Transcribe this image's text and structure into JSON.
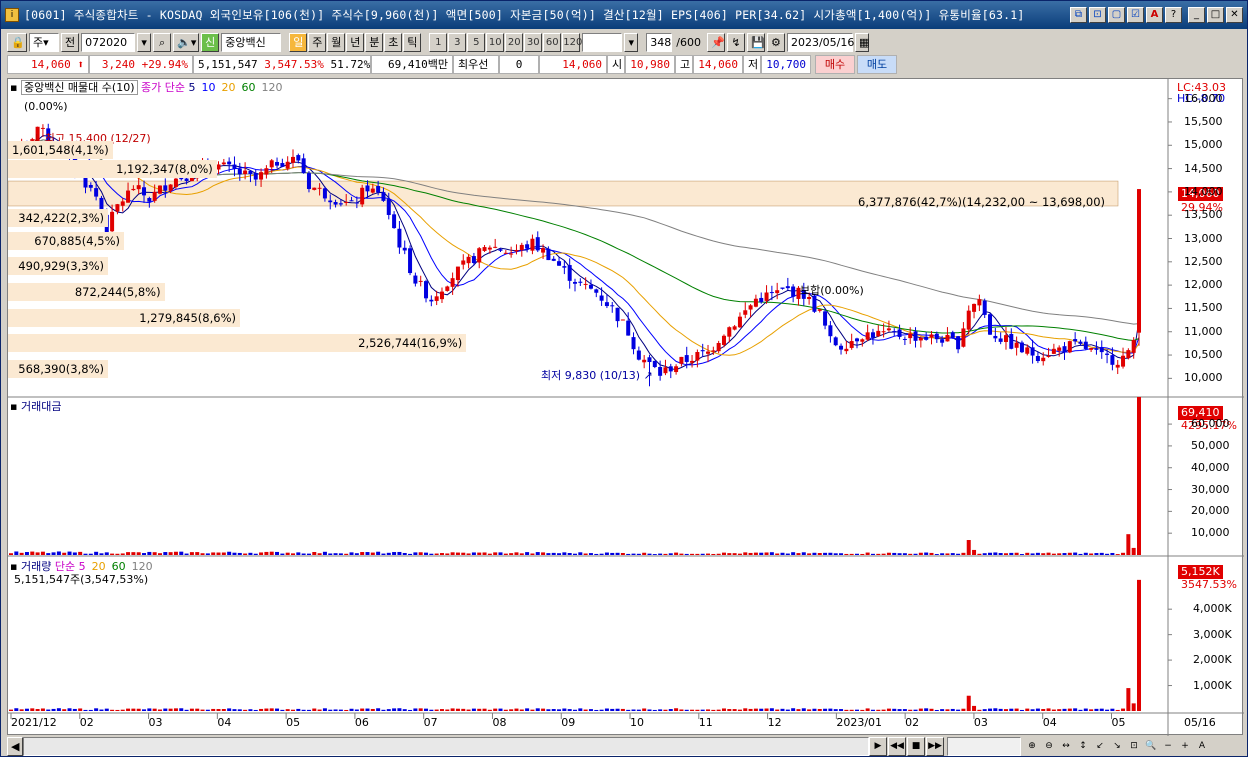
{
  "title": {
    "text": "[0601] 주식종합차트 - KOSDAQ 외국인보유[106(천)] 주식수[9,960(천)] 액면[500] 자본금[50(억)] 결산[12월] EPS[406] PER[34.62] 시가총액[1,400(억)] 유통비율[63.1]",
    "app_icon": "i"
  },
  "title_buttons": [
    {
      "name": "layout-icon",
      "glyph": "⧉"
    },
    {
      "name": "restore-icon",
      "glyph": "⊡"
    },
    {
      "name": "window-icon",
      "glyph": "▢"
    },
    {
      "name": "checkbox-icon",
      "glyph": "☑"
    },
    {
      "name": "font-icon",
      "glyph": "A"
    },
    {
      "name": "help-icon",
      "glyph": "?"
    },
    {
      "name": "minimize-icon",
      "glyph": "_"
    },
    {
      "name": "maximize-icon",
      "glyph": "□"
    },
    {
      "name": "close-icon",
      "glyph": "✕"
    }
  ],
  "toolbar": {
    "stock_type": "주",
    "prev_label": "전",
    "code": "072020",
    "stock_name": "중앙백신",
    "new_badge": "신",
    "periods": [
      "일",
      "주",
      "월",
      "년",
      "분",
      "초",
      "틱"
    ],
    "active_period": "일",
    "intervals": [
      "1",
      "3",
      "5",
      "10",
      "20",
      "30",
      "60",
      "120"
    ],
    "interval_input": "",
    "count": "348",
    "count_total": "/600",
    "date": "2023/05/16"
  },
  "quote": {
    "price": "14,060",
    "change": "3,240",
    "change_pct": "+29.94%",
    "volume": "5,151,547",
    "volume_pct": "3,547.53%",
    "turnover": "51.72%",
    "amount": "69,410백만",
    "bid_label": "최우선",
    "bid_value": "0",
    "ask_value": "14,060",
    "open_label": "시",
    "open": "10,980",
    "high_label": "고",
    "high": "14,060",
    "low_label": "저",
    "low": "10,700",
    "buy_label": "매수",
    "sell_label": "매도"
  },
  "price_panel": {
    "title": "중앙백신 매물대 수(10)",
    "ma_label": "종가 단순",
    "ma_periods": [
      "5",
      "10",
      "20",
      "60",
      "120"
    ],
    "ma_colors": [
      "#000080",
      "#0000ff",
      "#e8a000",
      "#008000",
      "#808080"
    ],
    "change_label": "(0.00%)",
    "lc": "LC:43.03",
    "hc": "HC:-8.70",
    "last_price_badge": "14,060",
    "last_pct": "29.94%",
    "high_marker": "최고 15,400 (12/27)",
    "low_marker": "최저 9,830 (10/13)",
    "flat_marker": "보합(0.00%)",
    "range_label": "6,377,876(42,7%)(14,232,00 ~ 13,698,00)",
    "volume_profile": [
      {
        "label": "1,601,548(4,1%)",
        "price": 14900,
        "width": 0.06
      },
      {
        "label": "1,192,347(8,0%)",
        "price": 14500,
        "width": 0.18
      },
      {
        "label": "342,422(2,3%)",
        "price": 13450,
        "width": 0.07
      },
      {
        "label": "670,885(4,5%)",
        "price": 12950,
        "width": 0.1
      },
      {
        "label": "490,929(3,3%)",
        "price": 12400,
        "width": 0.08
      },
      {
        "label": "872,244(5,8%)",
        "price": 11850,
        "width": 0.135
      },
      {
        "label": "1,279,845(8,6%)",
        "price": 11300,
        "width": 0.2
      },
      {
        "label": "2,526,744(16,9%)",
        "price": 10750,
        "width": 0.395
      },
      {
        "label": "568,390(3,8%)",
        "price": 10200,
        "width": 0.085
      }
    ],
    "yticks": [
      "16,000",
      "15,500",
      "15,000",
      "14,500",
      "14,000",
      "13,500",
      "13,000",
      "12,500",
      "12,000",
      "11,500",
      "11,000",
      "10,500",
      "10,000"
    ]
  },
  "amount_panel": {
    "title": "거래대금",
    "badge": "69,410",
    "pct": "4295.17%",
    "yticks": [
      "60,000",
      "50,000",
      "40,000",
      "30,000",
      "20,000",
      "10,000"
    ]
  },
  "volume_panel": {
    "title": "거래량",
    "ma_label": "단순",
    "ma_periods": [
      "5",
      "20",
      "60",
      "120"
    ],
    "ma_colors": [
      "#c800c8",
      "#e8a000",
      "#008000",
      "#808080"
    ],
    "value_text": "5,151,547주(3,547,53%)",
    "badge": "5,152K",
    "pct": "3547.53%",
    "yticks": [
      "4,000K",
      "3,000K",
      "2,000K",
      "1,000K"
    ]
  },
  "x_axis": {
    "labels": [
      "2021/12",
      "02",
      "03",
      "04",
      "05",
      "06",
      "07",
      "08",
      "09",
      "10",
      "11",
      "12",
      "2023/01",
      "02",
      "03",
      "04",
      "05"
    ],
    "last_label": "05/16"
  },
  "chart_data": {
    "type": "candlestick",
    "x_range": [
      "2021/12",
      "2023/05/16"
    ],
    "y_range": [
      9830,
      16000
    ],
    "close_path": [
      [
        0,
        14900
      ],
      [
        3,
        15000
      ],
      [
        5,
        15400
      ],
      [
        8,
        14950
      ],
      [
        12,
        14500
      ],
      [
        16,
        13900
      ],
      [
        18,
        13200
      ],
      [
        20,
        13700
      ],
      [
        23,
        14100
      ],
      [
        26,
        13850
      ],
      [
        30,
        14250
      ],
      [
        34,
        14400
      ],
      [
        38,
        14600
      ],
      [
        42,
        14450
      ],
      [
        46,
        14250
      ],
      [
        50,
        14650
      ],
      [
        54,
        14700
      ],
      [
        56,
        14150
      ],
      [
        60,
        13900
      ],
      [
        64,
        13700
      ],
      [
        67,
        14100
      ],
      [
        70,
        13850
      ],
      [
        73,
        12900
      ],
      [
        76,
        12100
      ],
      [
        79,
        11700
      ],
      [
        82,
        12100
      ],
      [
        86,
        12500
      ],
      [
        90,
        12850
      ],
      [
        94,
        12700
      ],
      [
        98,
        12900
      ],
      [
        101,
        12650
      ],
      [
        104,
        12300
      ],
      [
        107,
        12000
      ],
      [
        110,
        11850
      ],
      [
        113,
        11500
      ],
      [
        116,
        11000
      ],
      [
        118,
        10500
      ],
      [
        120,
        10300
      ],
      [
        122,
        10100
      ],
      [
        125,
        10300
      ],
      [
        128,
        10450
      ],
      [
        131,
        10550
      ],
      [
        134,
        11000
      ],
      [
        137,
        11300
      ],
      [
        140,
        11700
      ],
      [
        143,
        11800
      ],
      [
        146,
        11900
      ],
      [
        149,
        11800
      ],
      [
        152,
        11400
      ],
      [
        154,
        10800
      ],
      [
        156,
        10700
      ],
      [
        160,
        10950
      ],
      [
        165,
        10950
      ],
      [
        170,
        10900
      ],
      [
        175,
        10850
      ],
      [
        178,
        10750
      ],
      [
        180,
        11500
      ],
      [
        182,
        11700
      ],
      [
        184,
        11000
      ],
      [
        187,
        10800
      ],
      [
        190,
        10600
      ],
      [
        193,
        10500
      ],
      [
        196,
        10600
      ],
      [
        199,
        10700
      ],
      [
        202,
        10650
      ],
      [
        205,
        10450
      ],
      [
        208,
        10400
      ],
      [
        210,
        10500
      ],
      [
        211,
        10820
      ],
      [
        212,
        14060
      ]
    ],
    "notes": "Shape only — precise daily OHLC values are not printed; key printed values: 최고 15,400 (12/27), 최저 9,830 (10/13), last 14,060 (+29.94%)."
  },
  "bottom": {
    "nav": [
      "▶",
      "◀◀",
      "■",
      "▶▶"
    ],
    "tools": [
      "⊕",
      "⊖",
      "↔",
      "↕",
      "↙",
      "↘",
      "⊡",
      "🔍",
      "−",
      "+",
      "A"
    ]
  }
}
